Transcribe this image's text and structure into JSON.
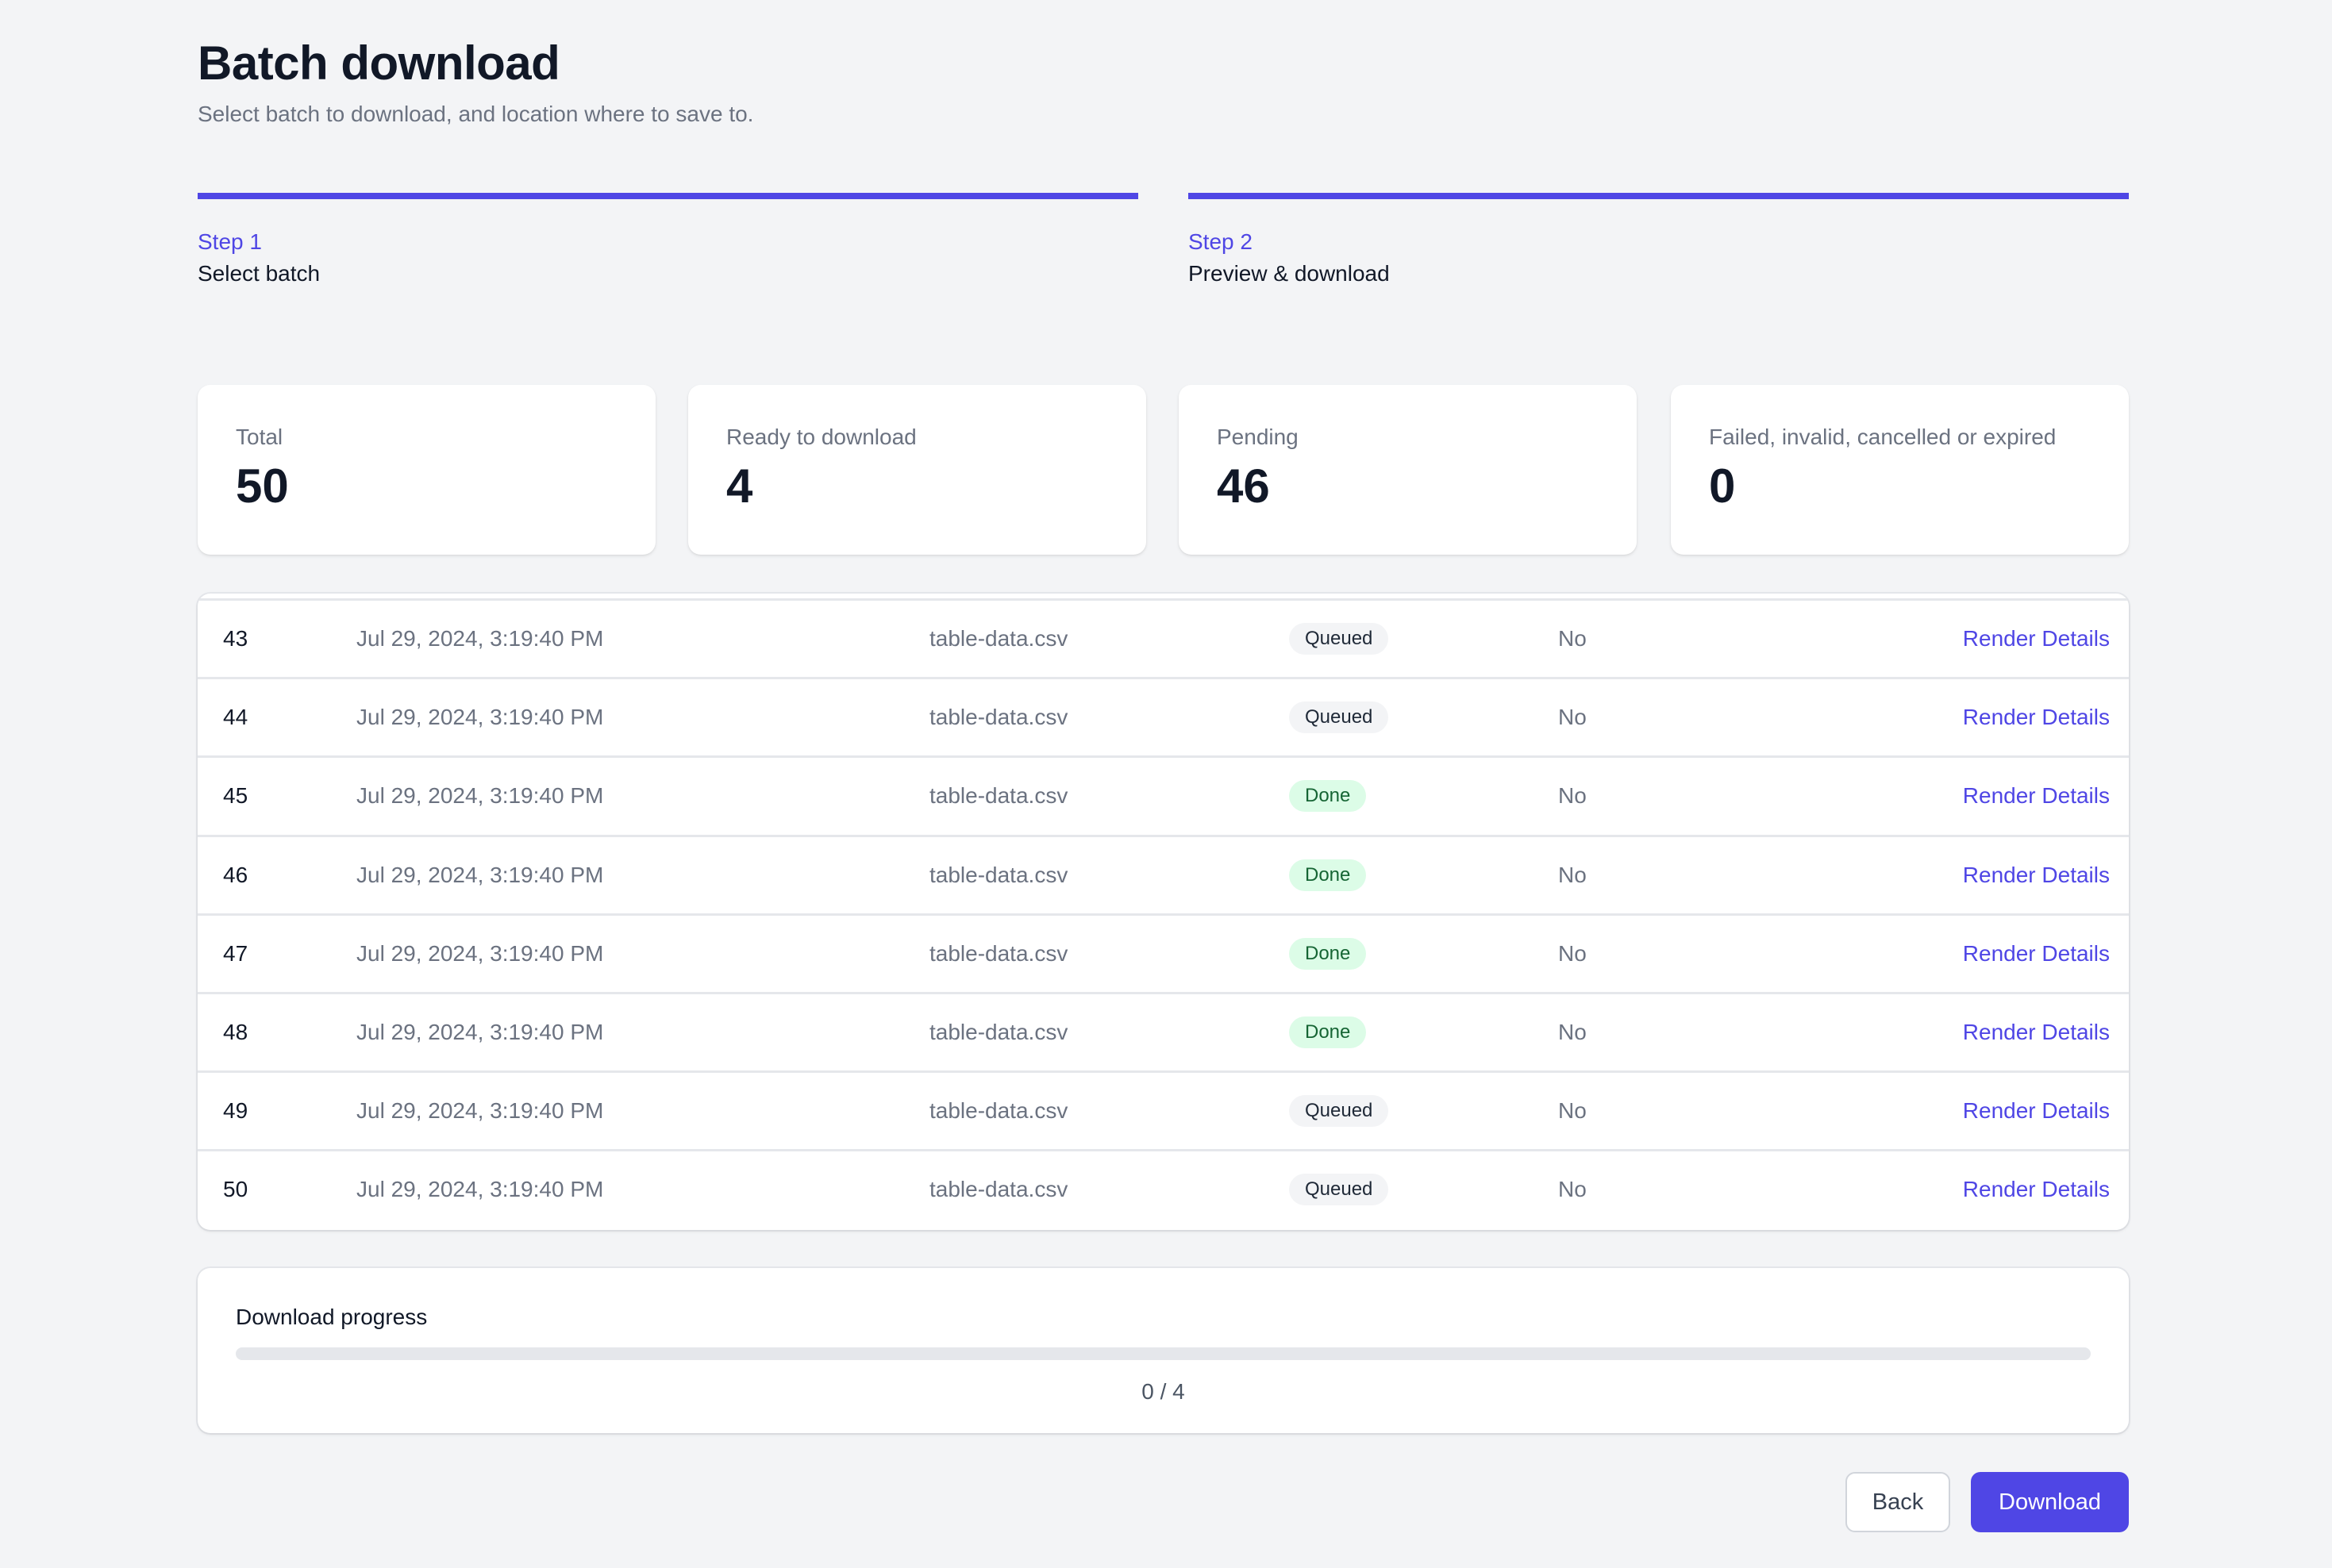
{
  "header": {
    "title": "Batch download",
    "subtitle": "Select batch to download, and location where to save to."
  },
  "steps": [
    {
      "number": "Step 1",
      "label": "Select batch",
      "complete": true
    },
    {
      "number": "Step 2",
      "label": "Preview & download",
      "complete": true
    }
  ],
  "stats": [
    {
      "label": "Total",
      "value": "50"
    },
    {
      "label": "Ready to download",
      "value": "4"
    },
    {
      "label": "Pending",
      "value": "46"
    },
    {
      "label": "Failed, invalid, cancelled or expired",
      "value": "0"
    }
  ],
  "table": {
    "rows": [
      {
        "id": "43",
        "date": "Jul 29, 2024, 3:19:40 PM",
        "file": "table-data.csv",
        "status": "Queued",
        "flag": "No",
        "action": "Render Details"
      },
      {
        "id": "44",
        "date": "Jul 29, 2024, 3:19:40 PM",
        "file": "table-data.csv",
        "status": "Queued",
        "flag": "No",
        "action": "Render Details"
      },
      {
        "id": "45",
        "date": "Jul 29, 2024, 3:19:40 PM",
        "file": "table-data.csv",
        "status": "Done",
        "flag": "No",
        "action": "Render Details"
      },
      {
        "id": "46",
        "date": "Jul 29, 2024, 3:19:40 PM",
        "file": "table-data.csv",
        "status": "Done",
        "flag": "No",
        "action": "Render Details"
      },
      {
        "id": "47",
        "date": "Jul 29, 2024, 3:19:40 PM",
        "file": "table-data.csv",
        "status": "Done",
        "flag": "No",
        "action": "Render Details"
      },
      {
        "id": "48",
        "date": "Jul 29, 2024, 3:19:40 PM",
        "file": "table-data.csv",
        "status": "Done",
        "flag": "No",
        "action": "Render Details"
      },
      {
        "id": "49",
        "date": "Jul 29, 2024, 3:19:40 PM",
        "file": "table-data.csv",
        "status": "Queued",
        "flag": "No",
        "action": "Render Details"
      },
      {
        "id": "50",
        "date": "Jul 29, 2024, 3:19:40 PM",
        "file": "table-data.csv",
        "status": "Queued",
        "flag": "No",
        "action": "Render Details"
      }
    ]
  },
  "progress": {
    "label": "Download progress",
    "completed": 0,
    "total": 4,
    "text": "0 / 4"
  },
  "actions": {
    "back_label": "Back",
    "download_label": "Download"
  },
  "colors": {
    "accent": "#4f46e5",
    "done_bg": "#dcfce7",
    "done_text": "#166534",
    "queued_bg": "#f3f4f6",
    "queued_text": "#1f2937"
  }
}
